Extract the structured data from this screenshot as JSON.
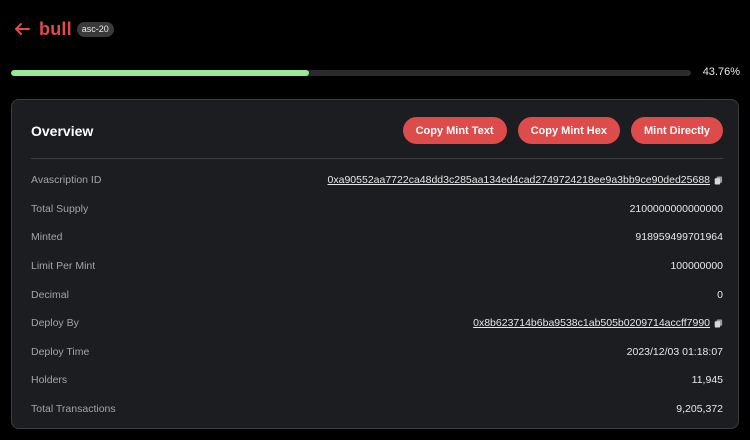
{
  "header": {
    "back_icon": "arrow-left-icon",
    "token_name": "bull",
    "badge": "asc-20",
    "accent_color": "#e24a4a"
  },
  "progress": {
    "percent_label": "43.76%",
    "fraction": 0.4376,
    "fill_color": "#9be89a"
  },
  "overview": {
    "title": "Overview",
    "buttons": {
      "copy_mint_text": "Copy Mint Text",
      "copy_mint_hex": "Copy Mint Hex",
      "mint_directly": "Mint Directly"
    },
    "button_color": "#dd4b4b",
    "rows": {
      "avascription_id": {
        "label": "Avascription ID",
        "value": "0xa90552aa7722ca48dd3c285aa134ed4cad2749724218ee9a3bb9ce90ded25688",
        "icon": "copy-icon"
      },
      "total_supply": {
        "label": "Total Supply",
        "value": "2100000000000000"
      },
      "minted": {
        "label": "Minted",
        "value": "918959499701964"
      },
      "limit_per_mint": {
        "label": "Limit Per Mint",
        "value": "100000000"
      },
      "decimal": {
        "label": "Decimal",
        "value": "0"
      },
      "deploy_by": {
        "label": "Deploy By",
        "value": "0x8b623714b6ba9538c1ab505b0209714accff7990",
        "icon": "copy-icon"
      },
      "deploy_time": {
        "label": "Deploy Time",
        "value": "2023/12/03 01:18:07"
      },
      "holders": {
        "label": "Holders",
        "value": "11,945"
      },
      "total_transactions": {
        "label": "Total Transactions",
        "value": "9,205,372"
      }
    }
  }
}
